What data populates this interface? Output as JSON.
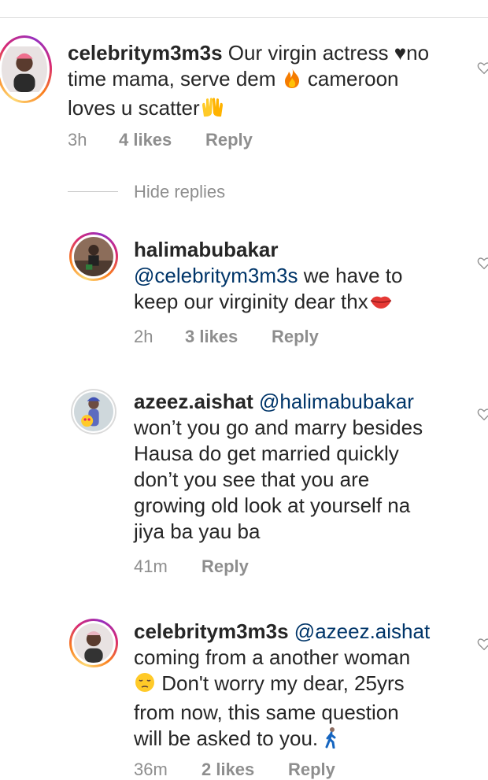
{
  "colors": {
    "text": "#262626",
    "meta": "#8e8e8e",
    "mention": "#003569"
  },
  "comments": [
    {
      "user": "celebritym3m3s",
      "lines": [
        "Our virgin actress ♥no",
        "time mama, serve dem",
        "cameroon",
        "loves u scatter"
      ],
      "time": "3h",
      "likes": "4 likes",
      "reply": "Reply",
      "emoji": [
        "fire",
        "raising-hands"
      ]
    },
    {
      "user": "halimabubakar",
      "mention": "@celebritym3m3s",
      "lines": [
        "we have to",
        "keep our virginity dear thx"
      ],
      "time": "2h",
      "likes": "3 likes",
      "reply": "Reply",
      "emoji": [
        "kiss-lips"
      ]
    },
    {
      "user": "azeez.aishat",
      "mention": "@halimabubakar",
      "lines": [
        "won’t you go and marry besides",
        "Hausa do get married quickly",
        "don’t you see that you are",
        "growing old look at yourself na",
        "jiya ba yau ba"
      ],
      "time": "41m",
      "reply": "Reply"
    },
    {
      "user": "celebritym3m3s",
      "mention": "@azeez.aishat",
      "lines": [
        "coming from a another woman",
        "Don't worry my dear, 25yrs",
        "from now, this same question",
        "will be asked to you."
      ],
      "time": "36m",
      "likes": "2 likes",
      "reply": "Reply",
      "emoji": [
        "pensive-face",
        "person-walking"
      ]
    }
  ],
  "hide_replies": "Hide replies"
}
